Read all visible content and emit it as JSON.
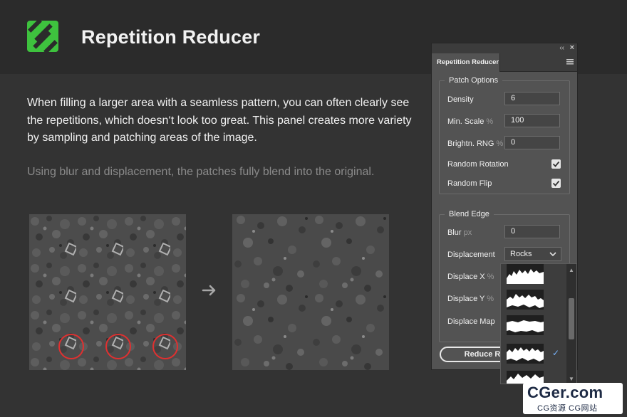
{
  "header": {
    "title": "Repetition Reducer",
    "logo_icon": "green-checker-logo-icon",
    "logo_color": "#3ec23e"
  },
  "content": {
    "intro": "When filling a larger area with a seamless pattern, you can often clearly see the repetitions, which doesn‘t look too great. This panel creates more variety by sampling and patching areas of the image.",
    "note": "Using blur and displacement, the patches fully blend into the original.",
    "arrow_icon": "arrow-right-icon",
    "highlight_color": "#e03030"
  },
  "panel": {
    "tab_label": "Repetition Reducer",
    "patch_options": {
      "label": "Patch Options",
      "density_label": "Density",
      "density_value": "6",
      "min_scale_label": "Min. Scale",
      "min_scale_unit": "%",
      "min_scale_value": "100",
      "brightness_label": "Brightn. RNG",
      "brightness_unit": "%",
      "brightness_value": "0",
      "random_rotation_label": "Random Rotation",
      "random_rotation_checked": true,
      "random_flip_label": "Random Flip",
      "random_flip_checked": true
    },
    "blend_edge": {
      "label": "Blend Edge",
      "blur_label": "Blur",
      "blur_unit": "px",
      "blur_value": "0",
      "displacement_label": "Displacement",
      "displacement_value": "Rocks",
      "displace_x_label": "Displace X",
      "displace_x_unit": "%",
      "displace_y_label": "Displace Y",
      "displace_y_unit": "%",
      "displace_map_label": "Displace Map"
    },
    "reduce_button_label": "Reduce R",
    "check_glyph": "✓"
  },
  "dropdown": {
    "item_count": 5,
    "selected_index": 3,
    "check_glyph": "✓"
  },
  "watermark": {
    "main": "CGer.com",
    "sub": "CG资源 CG网站"
  }
}
